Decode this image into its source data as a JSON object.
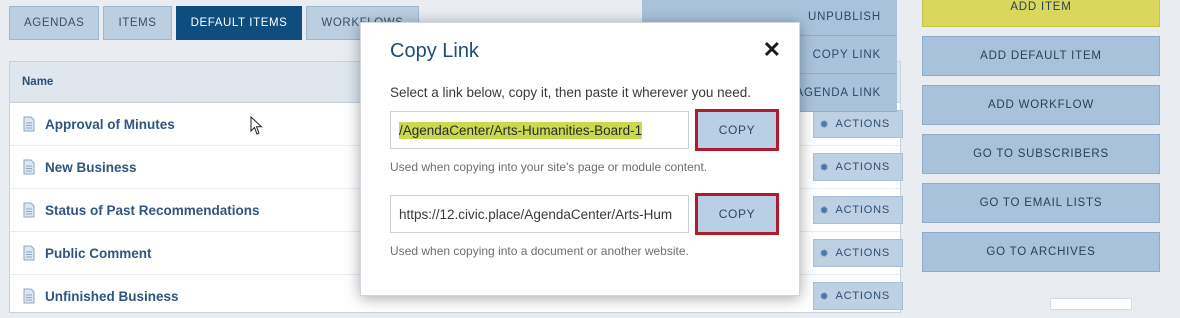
{
  "tabs": [
    {
      "label": "AGENDAS",
      "active": false
    },
    {
      "label": "ITEMS",
      "active": false
    },
    {
      "label": "DEFAULT ITEMS",
      "active": true
    },
    {
      "label": "WORKFLOWS",
      "active": false
    }
  ],
  "list": {
    "header": "Name",
    "rows": [
      {
        "title": "Approval of Minutes",
        "action": "ACTIONS"
      },
      {
        "title": "New Business",
        "action": "ACTIONS"
      },
      {
        "title": "Status of Past Recommendations",
        "action": "ACTIONS"
      },
      {
        "title": "Public Comment",
        "action": "ACTIONS"
      },
      {
        "title": "Unfinished Business",
        "action": "ACTIONS"
      }
    ]
  },
  "dropdown": [
    "UNPUBLISH",
    "COPY LINK",
    "AGENDA LINK"
  ],
  "sidebar": [
    {
      "label": "ADD ITEM",
      "primary": true
    },
    {
      "label": "ADD DEFAULT ITEM"
    },
    {
      "label": "ADD WORKFLOW"
    },
    {
      "label": "GO TO SUBSCRIBERS"
    },
    {
      "label": "GO TO EMAIL LISTS"
    },
    {
      "label": "GO TO ARCHIVES"
    }
  ],
  "modal": {
    "title": "Copy Link",
    "close_symbol": "✕",
    "intro": "Select a link below, copy it, then paste it wherever you need.",
    "relative": {
      "value": "/AgendaCenter/Arts-Humanities-Board-1",
      "button": "COPY",
      "help": "Used when copying into your site's page or module content."
    },
    "absolute": {
      "value": "https://12.civic.place/AgendaCenter/Arts-Hum",
      "button": "COPY",
      "help": "Used when copying into a document or another website."
    }
  },
  "colors": {
    "active_tab": "#0f4d7f",
    "primary_button": "#d9d85c",
    "highlight_border": "#b01c2e",
    "text_highlight": "#cbd94e"
  },
  "icons": {
    "row": "document-icon",
    "actions": "gear-icon",
    "close": "close-icon",
    "cursor": "mouse-pointer-icon"
  }
}
